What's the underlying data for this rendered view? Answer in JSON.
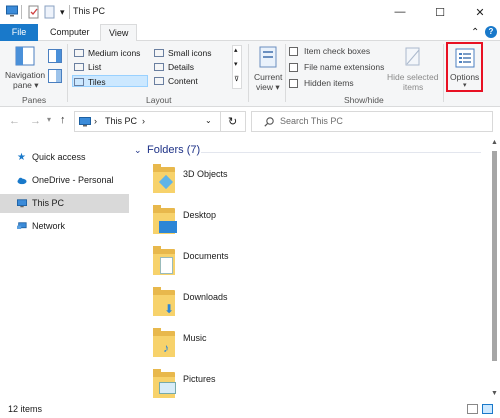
{
  "window": {
    "title": "This PC"
  },
  "tabs": [
    {
      "label": "File"
    },
    {
      "label": "Computer"
    },
    {
      "label": "View"
    }
  ],
  "ribbon": {
    "panes": {
      "nav_pane_label": "Navigation pane",
      "nav_pane_line1": "Navigation",
      "nav_pane_line2": "pane ▾",
      "caption": "Panes"
    },
    "layout": {
      "caption": "Layout",
      "items": [
        "Medium icons",
        "Small icons",
        "List",
        "Details",
        "Tiles",
        "Content"
      ]
    },
    "current_view": {
      "line1": "Current",
      "line2": "view ▾"
    },
    "show_hide": {
      "caption": "Show/hide",
      "item_check_boxes": "Item check boxes",
      "file_name_extensions": "File name extensions",
      "hidden_items": "Hidden items",
      "hide_selected_line1": "Hide selected",
      "hide_selected_line2": "items"
    },
    "options": {
      "label": "Options",
      "highlight_color": "#e81123"
    }
  },
  "address": {
    "path": "This PC",
    "sep": "›",
    "search_placeholder": "Search This PC"
  },
  "nav_pane": [
    {
      "label": "Quick access",
      "icon": "star-icon"
    },
    {
      "label": "OneDrive - Personal",
      "icon": "cloud-icon"
    },
    {
      "label": "This PC",
      "icon": "pc-icon",
      "selected": true
    },
    {
      "label": "Network",
      "icon": "network-icon"
    }
  ],
  "main": {
    "group_header": "Folders (7)",
    "folders": [
      "3D Objects",
      "Desktop",
      "Documents",
      "Downloads",
      "Music",
      "Pictures"
    ]
  },
  "status": {
    "count": "12 items"
  },
  "colors": {
    "accent": "#1979ca",
    "selected_bg": "#cce8ff",
    "nav_selected_bg": "#d9d9d9"
  }
}
